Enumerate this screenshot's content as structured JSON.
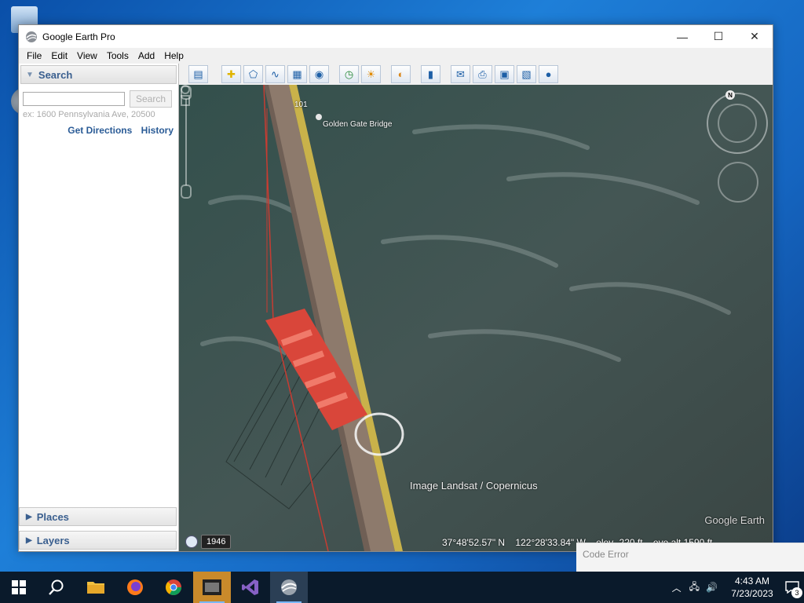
{
  "window": {
    "title": "Google Earth Pro",
    "minimize_glyph": "—",
    "maximize_glyph": "☐",
    "close_glyph": "✕"
  },
  "menu": [
    "File",
    "Edit",
    "View",
    "Tools",
    "Add",
    "Help"
  ],
  "search_panel": {
    "header": "Search",
    "input_value": "",
    "search_button": "Search",
    "hint": "ex: 1600 Pennsylvania Ave, 20500",
    "get_directions": "Get Directions",
    "history": "History"
  },
  "places_label": "Places",
  "layers_label": "Layers",
  "map": {
    "placemark_label": "Golden Gate Bridge",
    "route_shield": "101",
    "attribution": "Image Landsat / Copernicus",
    "logo": "Google Earth",
    "compass_n": "N",
    "year": "1946",
    "lat": "37°48'52.57\" N",
    "lon": "122°28'33.84\" W",
    "elev": "elev  -220 ft",
    "eye_alt": "eye alt  1590 ft"
  },
  "popup": {
    "title": "Code Error"
  },
  "taskbar": {
    "time": "4:43 AM",
    "date": "7/23/2023",
    "notification_count": "3"
  },
  "colors": {
    "water": "#3e4e4b",
    "bridge_red": "#d9463a",
    "link_blue": "#2a5b96",
    "taskbar": "#0a1a2b"
  }
}
